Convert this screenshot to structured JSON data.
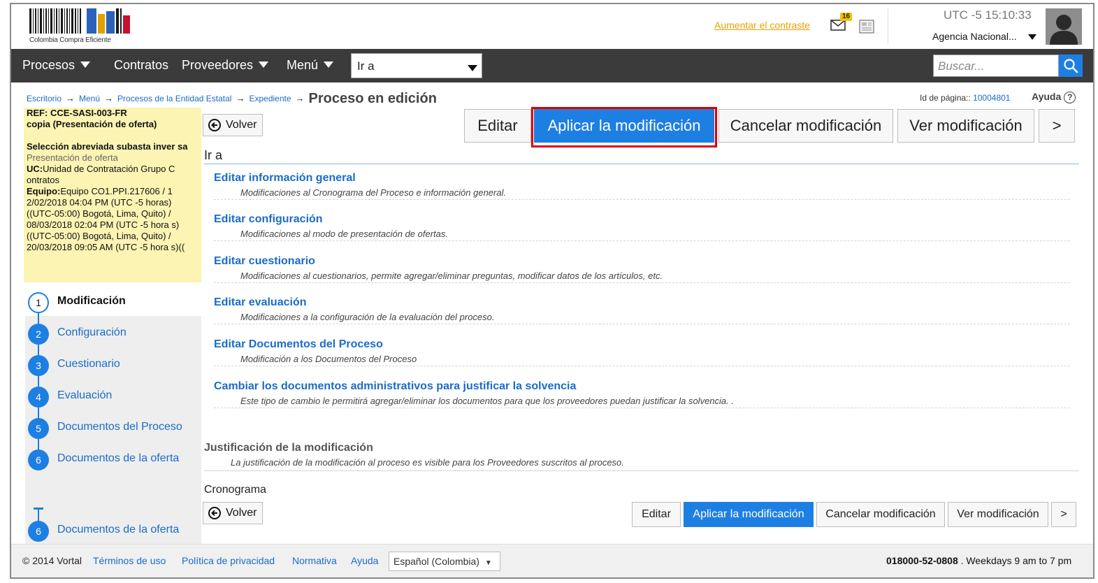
{
  "brand": {
    "logo_text": "Colombia Compra Eficiente",
    "contrast_link": "Aumentar el contraste",
    "mail_count": "16",
    "clock_tz": "UTC -5",
    "clock_time": "15:10:33",
    "agency": "Agencia Nacional..."
  },
  "nav": {
    "procesos": "Procesos",
    "contratos": "Contratos",
    "proveedores": "Proveedores",
    "menu": "Menú",
    "goto_value": "Ir a",
    "search_placeholder": "Buscar..."
  },
  "breadcrumb": {
    "items": [
      "Escritorio",
      "Menú",
      "Procesos de la Entidad Estatal",
      "Expediente"
    ],
    "current": "Proceso en edición"
  },
  "page_meta": {
    "page_id_label": "Id de página::",
    "page_id": "10004801",
    "help": "Ayuda"
  },
  "info": {
    "ref": "REF: CCE-SASI-003-FR",
    "copy": "copia (Presentación de oferta)",
    "type": "Selección abreviada subasta inver sa",
    "phase": "Presentación de oferta",
    "uc_label": "UC:",
    "uc_value": "Unidad de Contratación Grupo C ontratos",
    "team_label": "Equipo:",
    "team_value": "Equipo CO1.PPI.217606 / 1 2/02/2018 04:04 PM (UTC -5 horas) ((UTC-05:00) Bogotá, Lima, Quito) / 08/03/2018 02:04 PM (UTC -5 hora s)((UTC-05:00) Bogotá, Lima, Quito) / 20/03/2018 09:05 AM (UTC -5 hora s)(("
  },
  "steps": [
    {
      "num": "1",
      "label": "Modificación"
    },
    {
      "num": "2",
      "label": "Configuración"
    },
    {
      "num": "3",
      "label": "Cuestionario"
    },
    {
      "num": "4",
      "label": "Evaluación"
    },
    {
      "num": "5",
      "label": "Documentos del Proceso"
    },
    {
      "num": "6",
      "label": "Documentos de la oferta"
    }
  ],
  "step_bottom": {
    "num": "6",
    "label": "Documentos de la oferta"
  },
  "actions": {
    "back": "Volver",
    "edit": "Editar",
    "apply": "Aplicar la modificación",
    "cancel": "Cancelar modificación",
    "view": "Ver modificación",
    "next": ">"
  },
  "section": {
    "title": "Ir a",
    "entries": [
      {
        "title": "Editar información general",
        "desc": "Modificaciones al Cronograma del Proceso e información general."
      },
      {
        "title": "Editar configuración",
        "desc": "Modificaciones al modo de presentación de ofertas."
      },
      {
        "title": "Editar cuestionario",
        "desc": "Modificaciones al cuestionarios, permite agregar/eliminar preguntas, modificar datos de los artículos, etc."
      },
      {
        "title": "Editar evaluación",
        "desc": "Modificaciones a la configuración de la evaluación del proceso."
      },
      {
        "title": "Editar Documentos del Proceso",
        "desc": "Modificación a los Documentos del Proceso"
      },
      {
        "title": "Cambiar los documentos administrativos para justificar la solvencia",
        "desc": "Este tipo de cambio le permitirá agregar/eliminar los documentos para que los proveedores puedan justificar la solvencia. ."
      }
    ]
  },
  "justification": {
    "title": "Justificación de la modificación",
    "desc": "La justificación de la modificación al proceso es visible para los Proveedores suscritos al proceso."
  },
  "cronograma": "Cronograma",
  "footer": {
    "copyright": "© 2014 Vortal",
    "terms": "Términos de uso",
    "privacy": "Política de privacidad",
    "rules": "Normativa",
    "help": "Ayuda",
    "language": "Español (Colombia)",
    "phone": "018000-52-0808",
    "hours": ". Weekdays 9 am to 7 pm"
  },
  "colors": {
    "accent": "#1e7fe3",
    "link": "#1a6cc8",
    "nav_bg": "#3b3b3b",
    "info_bg": "#fbf4b3",
    "highlight": "#e00000"
  }
}
